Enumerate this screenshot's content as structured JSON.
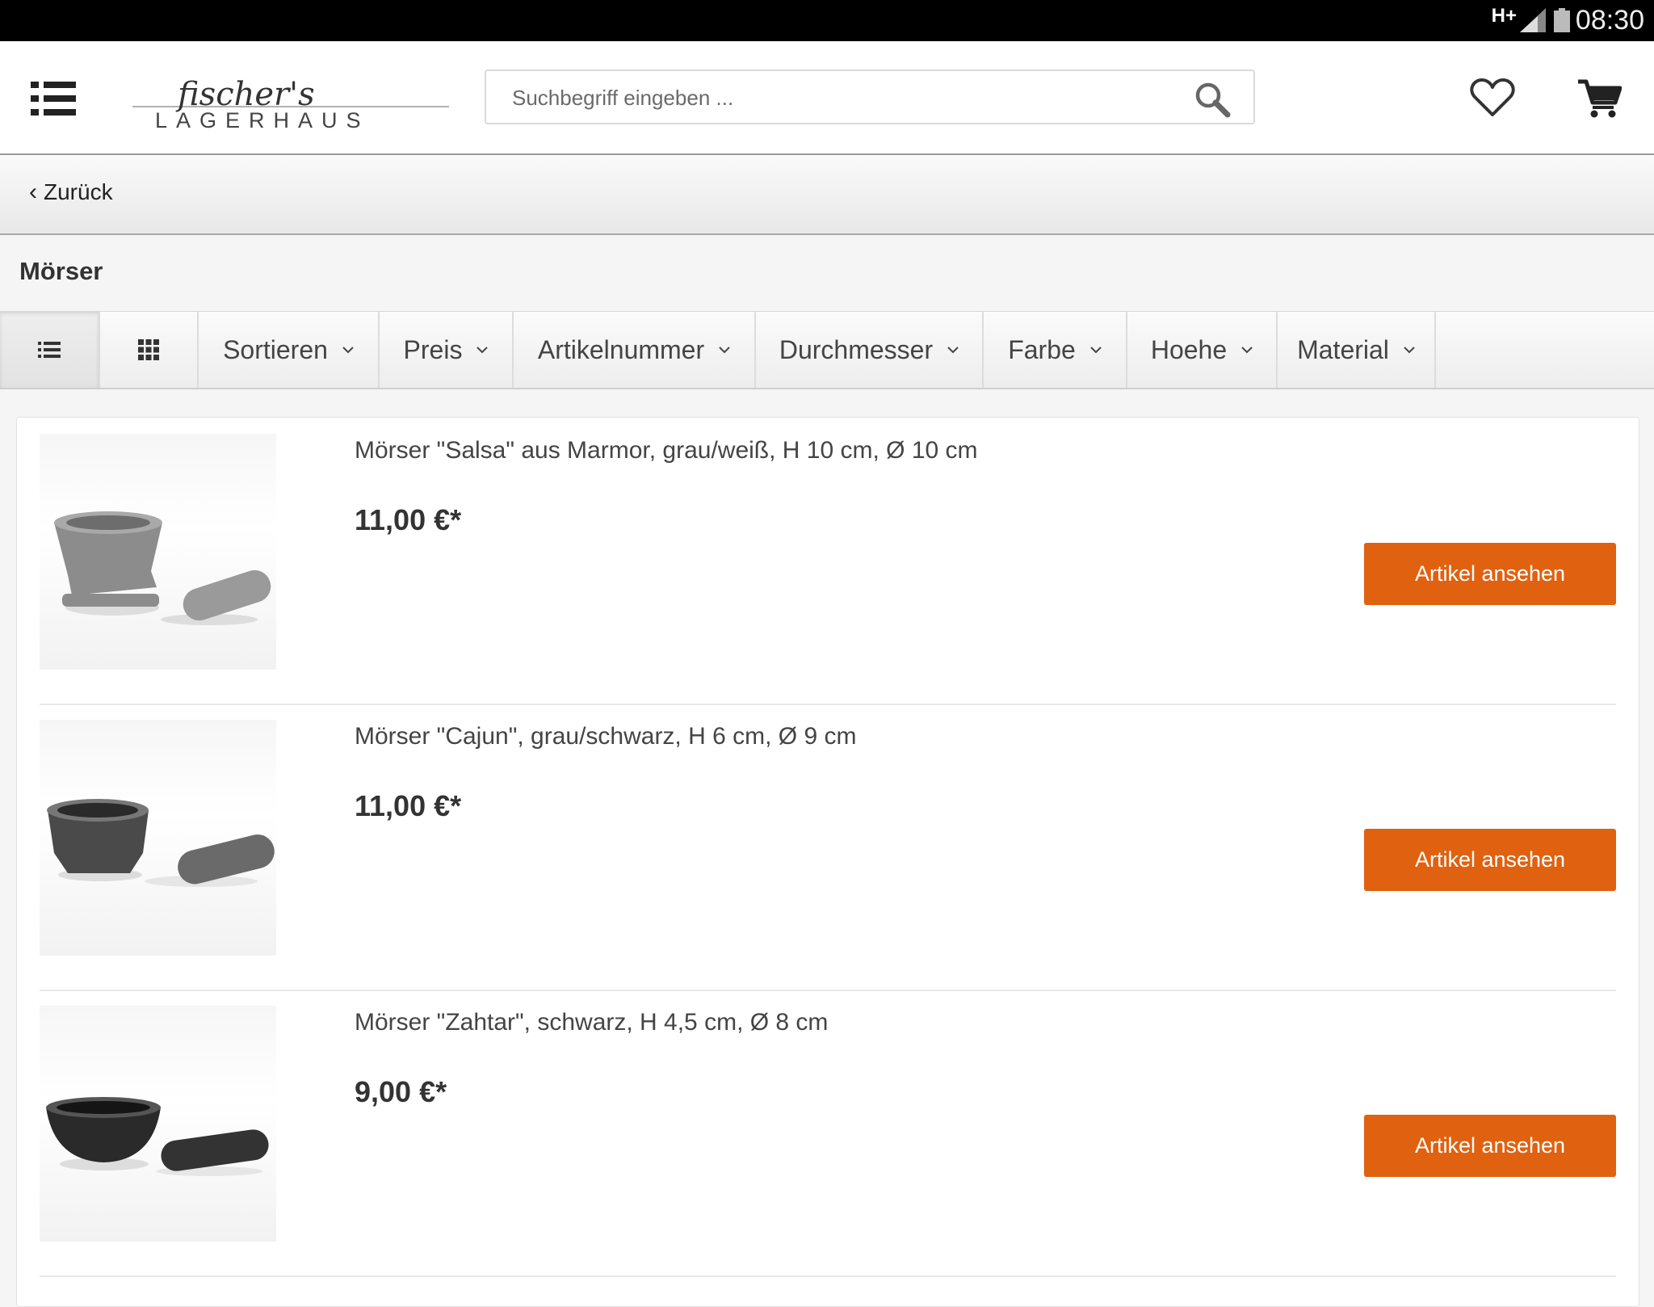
{
  "status_bar": {
    "network": "H+",
    "time": "08:30"
  },
  "header": {
    "logo_text_script": "fischer's",
    "logo_text_caps": "LAGERHAUS",
    "search_placeholder": "Suchbegriff eingeben ..."
  },
  "nav": {
    "back_label": "Zurück"
  },
  "category": {
    "title": "Mörser"
  },
  "filter_bar": {
    "filters": [
      {
        "label": "Sortieren"
      },
      {
        "label": "Preis"
      },
      {
        "label": "Artikelnummer"
      },
      {
        "label": "Durchmesser"
      },
      {
        "label": "Farbe"
      },
      {
        "label": "Hoehe"
      },
      {
        "label": "Material"
      }
    ]
  },
  "products": [
    {
      "title": "Mörser \"Salsa\" aus Marmor, grau/weiß, H 10 cm, Ø 10 cm",
      "price": "11,00 €*",
      "button": "Artikel ansehen",
      "mortar_color": "#8c8c8c",
      "pestle_color": "#9a9a9a"
    },
    {
      "title": "Mörser \"Cajun\", grau/schwarz, H 6 cm, Ø 9 cm",
      "price": "11,00 €*",
      "button": "Artikel ansehen",
      "mortar_color": "#4a4a4a",
      "pestle_color": "#6a6a6a"
    },
    {
      "title": "Mörser \"Zahtar\", schwarz, H 4,5 cm, Ø 8 cm",
      "price": "9,00 €*",
      "button": "Artikel ansehen",
      "mortar_color": "#2a2a2a",
      "pestle_color": "#333333"
    }
  ],
  "colors": {
    "accent": "#e0610f"
  }
}
